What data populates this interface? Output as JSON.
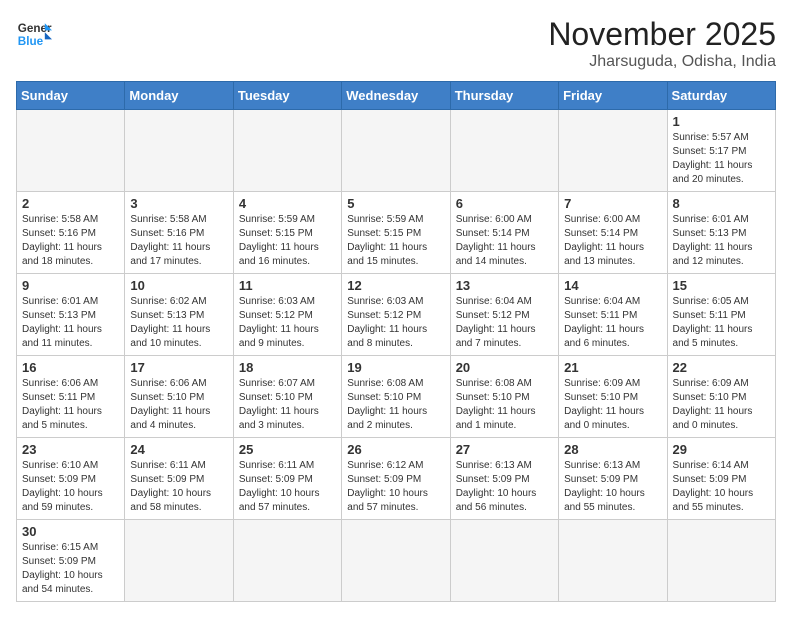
{
  "header": {
    "logo_text_general": "General",
    "logo_text_blue": "Blue",
    "title": "November 2025",
    "subtitle": "Jharsuguda, Odisha, India"
  },
  "weekdays": [
    "Sunday",
    "Monday",
    "Tuesday",
    "Wednesday",
    "Thursday",
    "Friday",
    "Saturday"
  ],
  "weeks": [
    [
      {
        "day": "",
        "info": ""
      },
      {
        "day": "",
        "info": ""
      },
      {
        "day": "",
        "info": ""
      },
      {
        "day": "",
        "info": ""
      },
      {
        "day": "",
        "info": ""
      },
      {
        "day": "",
        "info": ""
      },
      {
        "day": "1",
        "info": "Sunrise: 5:57 AM\nSunset: 5:17 PM\nDaylight: 11 hours and 20 minutes."
      }
    ],
    [
      {
        "day": "2",
        "info": "Sunrise: 5:58 AM\nSunset: 5:16 PM\nDaylight: 11 hours and 18 minutes."
      },
      {
        "day": "3",
        "info": "Sunrise: 5:58 AM\nSunset: 5:16 PM\nDaylight: 11 hours and 17 minutes."
      },
      {
        "day": "4",
        "info": "Sunrise: 5:59 AM\nSunset: 5:15 PM\nDaylight: 11 hours and 16 minutes."
      },
      {
        "day": "5",
        "info": "Sunrise: 5:59 AM\nSunset: 5:15 PM\nDaylight: 11 hours and 15 minutes."
      },
      {
        "day": "6",
        "info": "Sunrise: 6:00 AM\nSunset: 5:14 PM\nDaylight: 11 hours and 14 minutes."
      },
      {
        "day": "7",
        "info": "Sunrise: 6:00 AM\nSunset: 5:14 PM\nDaylight: 11 hours and 13 minutes."
      },
      {
        "day": "8",
        "info": "Sunrise: 6:01 AM\nSunset: 5:13 PM\nDaylight: 11 hours and 12 minutes."
      }
    ],
    [
      {
        "day": "9",
        "info": "Sunrise: 6:01 AM\nSunset: 5:13 PM\nDaylight: 11 hours and 11 minutes."
      },
      {
        "day": "10",
        "info": "Sunrise: 6:02 AM\nSunset: 5:13 PM\nDaylight: 11 hours and 10 minutes."
      },
      {
        "day": "11",
        "info": "Sunrise: 6:03 AM\nSunset: 5:12 PM\nDaylight: 11 hours and 9 minutes."
      },
      {
        "day": "12",
        "info": "Sunrise: 6:03 AM\nSunset: 5:12 PM\nDaylight: 11 hours and 8 minutes."
      },
      {
        "day": "13",
        "info": "Sunrise: 6:04 AM\nSunset: 5:12 PM\nDaylight: 11 hours and 7 minutes."
      },
      {
        "day": "14",
        "info": "Sunrise: 6:04 AM\nSunset: 5:11 PM\nDaylight: 11 hours and 6 minutes."
      },
      {
        "day": "15",
        "info": "Sunrise: 6:05 AM\nSunset: 5:11 PM\nDaylight: 11 hours and 5 minutes."
      }
    ],
    [
      {
        "day": "16",
        "info": "Sunrise: 6:06 AM\nSunset: 5:11 PM\nDaylight: 11 hours and 5 minutes."
      },
      {
        "day": "17",
        "info": "Sunrise: 6:06 AM\nSunset: 5:10 PM\nDaylight: 11 hours and 4 minutes."
      },
      {
        "day": "18",
        "info": "Sunrise: 6:07 AM\nSunset: 5:10 PM\nDaylight: 11 hours and 3 minutes."
      },
      {
        "day": "19",
        "info": "Sunrise: 6:08 AM\nSunset: 5:10 PM\nDaylight: 11 hours and 2 minutes."
      },
      {
        "day": "20",
        "info": "Sunrise: 6:08 AM\nSunset: 5:10 PM\nDaylight: 11 hours and 1 minute."
      },
      {
        "day": "21",
        "info": "Sunrise: 6:09 AM\nSunset: 5:10 PM\nDaylight: 11 hours and 0 minutes."
      },
      {
        "day": "22",
        "info": "Sunrise: 6:09 AM\nSunset: 5:10 PM\nDaylight: 11 hours and 0 minutes."
      }
    ],
    [
      {
        "day": "23",
        "info": "Sunrise: 6:10 AM\nSunset: 5:09 PM\nDaylight: 10 hours and 59 minutes."
      },
      {
        "day": "24",
        "info": "Sunrise: 6:11 AM\nSunset: 5:09 PM\nDaylight: 10 hours and 58 minutes."
      },
      {
        "day": "25",
        "info": "Sunrise: 6:11 AM\nSunset: 5:09 PM\nDaylight: 10 hours and 57 minutes."
      },
      {
        "day": "26",
        "info": "Sunrise: 6:12 AM\nSunset: 5:09 PM\nDaylight: 10 hours and 57 minutes."
      },
      {
        "day": "27",
        "info": "Sunrise: 6:13 AM\nSunset: 5:09 PM\nDaylight: 10 hours and 56 minutes."
      },
      {
        "day": "28",
        "info": "Sunrise: 6:13 AM\nSunset: 5:09 PM\nDaylight: 10 hours and 55 minutes."
      },
      {
        "day": "29",
        "info": "Sunrise: 6:14 AM\nSunset: 5:09 PM\nDaylight: 10 hours and 55 minutes."
      }
    ],
    [
      {
        "day": "30",
        "info": "Sunrise: 6:15 AM\nSunset: 5:09 PM\nDaylight: 10 hours and 54 minutes."
      },
      {
        "day": "",
        "info": ""
      },
      {
        "day": "",
        "info": ""
      },
      {
        "day": "",
        "info": ""
      },
      {
        "day": "",
        "info": ""
      },
      {
        "day": "",
        "info": ""
      },
      {
        "day": "",
        "info": ""
      }
    ]
  ]
}
